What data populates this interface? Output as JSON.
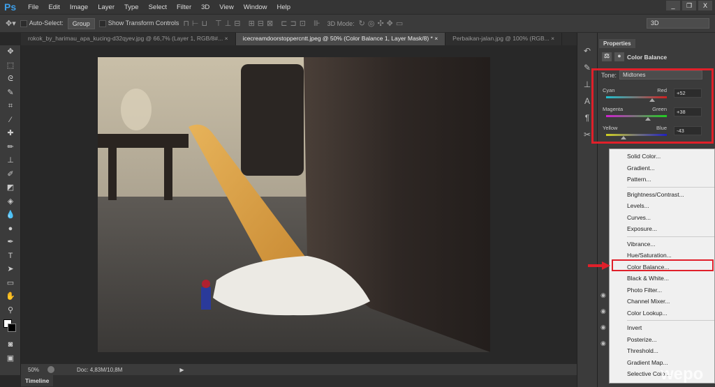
{
  "app": {
    "logo": "Ps",
    "menu": [
      "File",
      "Edit",
      "Image",
      "Layer",
      "Type",
      "Select",
      "Filter",
      "3D",
      "View",
      "Window",
      "Help"
    ],
    "window_controls": [
      "_",
      "❐",
      "X"
    ]
  },
  "options": {
    "auto_select_label": "Auto-Select:",
    "auto_select_value": "Group",
    "show_transform_label": "Show Transform Controls",
    "mode_3d_label": "3D Mode:",
    "workspace": "3D"
  },
  "tabs": [
    {
      "label": "rokok_by_harimau_apa_kucing-d32qyev.jpg @ 66,7% (Layer 1, RGB/8#...",
      "close": "×"
    },
    {
      "label": "icecreamdoorstoppercntt.jpeg @ 50% (Color Balance 1, Layer Mask/8) *",
      "close": "×"
    },
    {
      "label": "Perbaikan-jalan.jpg @ 100% (RGB...",
      "close": "×"
    }
  ],
  "status": {
    "zoom": "50%",
    "doc": "Doc: 4,83M/10,8M"
  },
  "timeline": {
    "label": "Timeline"
  },
  "properties": {
    "tab": "Properties",
    "title": "Color Balance",
    "tone_label": "Tone:",
    "tone_value": "Midtones",
    "sliders": [
      {
        "left": "Cyan",
        "right": "Red",
        "value": "+52",
        "num": 52,
        "gradient": [
          "#20c0d0",
          "#d02020"
        ]
      },
      {
        "left": "Magenta",
        "right": "Green",
        "value": "+38",
        "num": 38,
        "gradient": [
          "#d020d0",
          "#20d020"
        ]
      },
      {
        "left": "Yellow",
        "right": "Blue",
        "value": "-43",
        "num": -43,
        "gradient": [
          "#d0d020",
          "#2020c0"
        ]
      }
    ]
  },
  "menu_items": [
    [
      "Solid Color...",
      "Gradient...",
      "Pattern..."
    ],
    [
      "Brightness/Contrast...",
      "Levels...",
      "Curves...",
      "Exposure..."
    ],
    [
      "Vibrance...",
      "Hue/Saturation...",
      "Color Balance...",
      "Black & White...",
      "Photo Filter...",
      "Channel Mixer...",
      "Color Lookup..."
    ],
    [
      "Invert",
      "Posterize...",
      "Threshold...",
      "Gradient Map...",
      "Selective Color..."
    ]
  ],
  "highlighted_item": "Color Balance...",
  "watermark": "wepo",
  "colors": {
    "highlight": "#e0202a",
    "ps_blue": "#3d9ee8"
  }
}
